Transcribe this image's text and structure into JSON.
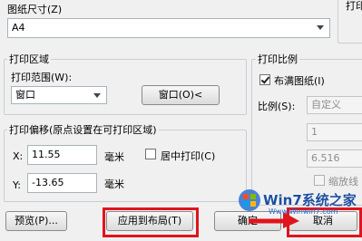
{
  "paper_size": {
    "label": "图纸尺寸(Z)",
    "value": "A4"
  },
  "plot_area": {
    "title": "打印区域",
    "range_label": "打印范围(W):",
    "range_value": "窗口",
    "window_button": "窗口(O)<"
  },
  "plot_offset": {
    "title": "打印偏移(原点设置在可打印区域)",
    "x_label": "X:",
    "x_value": "11.55",
    "x_unit": "毫米",
    "y_label": "Y:",
    "y_value": "-13.65",
    "y_unit": "毫米",
    "center_label": "居中打印(C)"
  },
  "plot_scale": {
    "title": "打印比例",
    "fit_label": "布满图纸(I)",
    "scale_label": "比例(S):",
    "scale_value": "自定义",
    "value1": "1",
    "value2": "6.516",
    "lineweights_label": "缩放线"
  },
  "right_top_label": "打印",
  "buttons": {
    "preview": "预览(P)...",
    "apply_layout": "应用到布局(T)",
    "ok": "确定",
    "cancel": "取消"
  },
  "watermark": {
    "brand": "Win7系统之家",
    "url": "Www.Winwin7.com"
  },
  "colors": {
    "highlight": "#e0141e",
    "dialog_bg": "#f0f0f0"
  }
}
